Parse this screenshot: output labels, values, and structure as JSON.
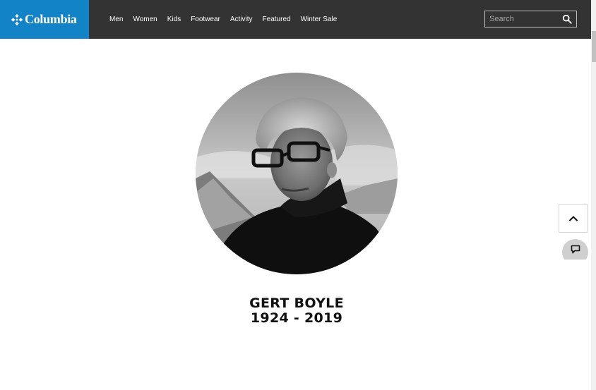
{
  "brand": {
    "name": "Columbia",
    "color": "#1283c6"
  },
  "nav": {
    "items": [
      {
        "label": "Men"
      },
      {
        "label": "Women"
      },
      {
        "label": "Kids"
      },
      {
        "label": "Footwear"
      },
      {
        "label": "Activity"
      },
      {
        "label": "Featured"
      },
      {
        "label": "Winter Sale"
      }
    ]
  },
  "search": {
    "placeholder": "Search",
    "value": ""
  },
  "tribute": {
    "name": "GERT BOYLE",
    "years": "1924 - 2019"
  },
  "icons": {
    "search": "search-icon",
    "back_to_top": "chevron-up-icon",
    "chat": "chat-icon"
  },
  "colors": {
    "header_bg": "#333333",
    "page_bg": "#ffffff"
  }
}
